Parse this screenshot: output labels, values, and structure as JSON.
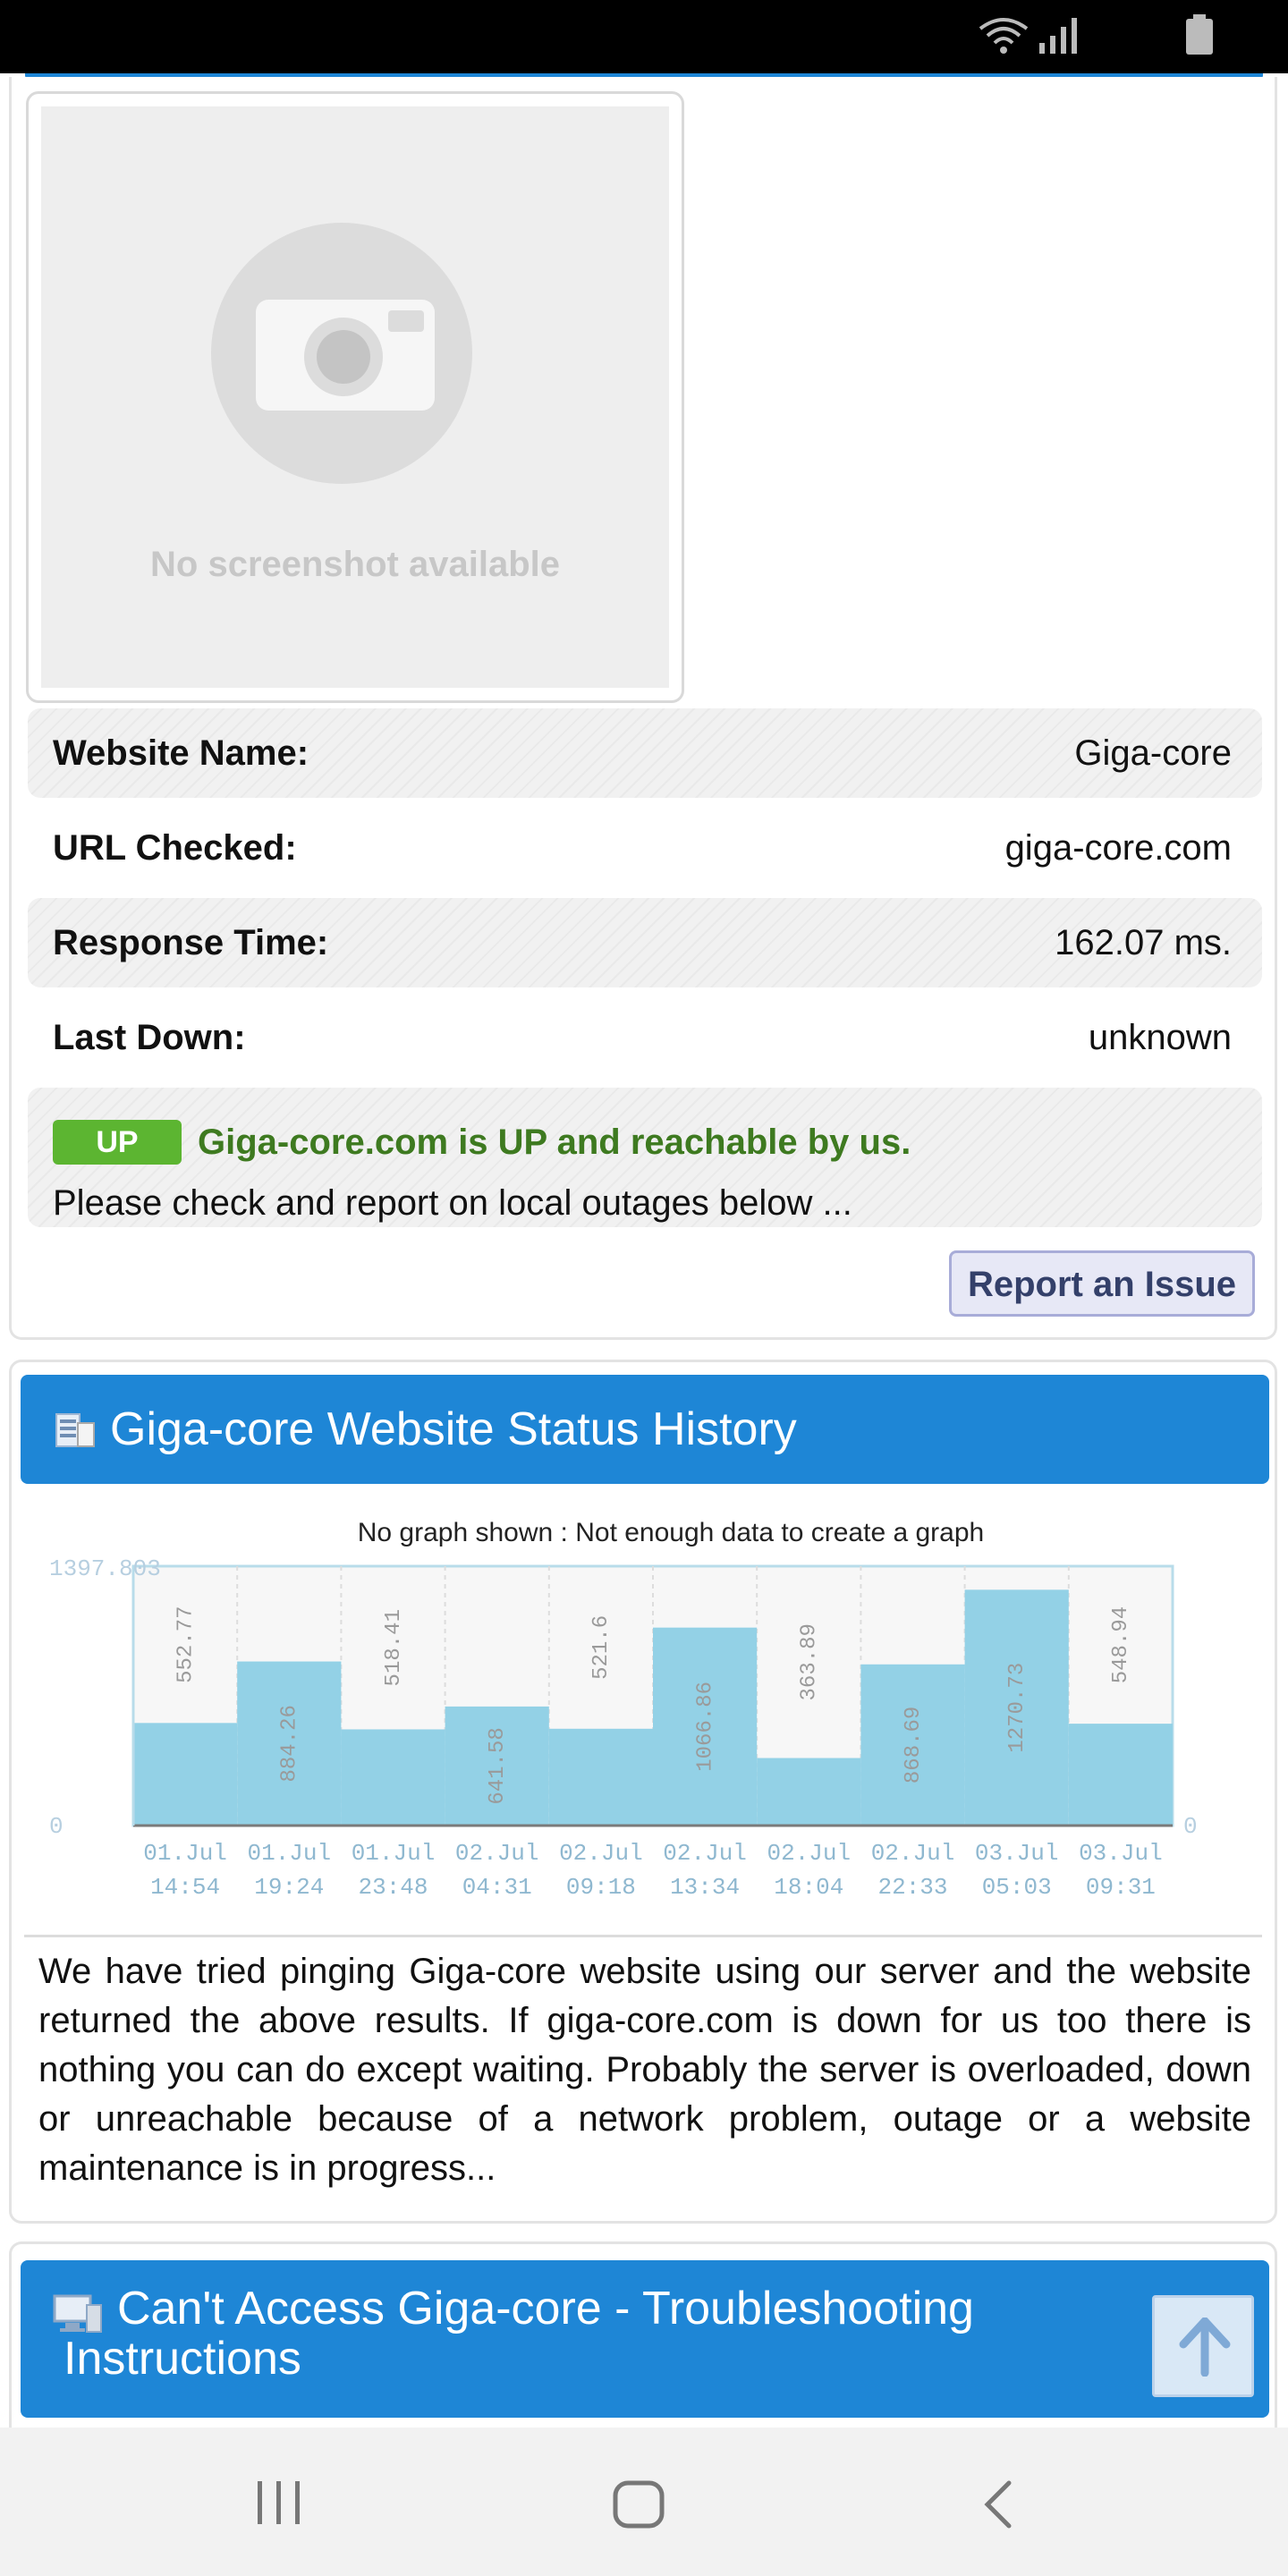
{
  "screenshot": {
    "placeholder_text": "No screenshot available"
  },
  "info_rows": [
    {
      "label": "Website Name:",
      "value": "Giga-core"
    },
    {
      "label": "URL Checked:",
      "value": "giga-core.com"
    },
    {
      "label": "Response Time:",
      "value": "162.07 ms."
    },
    {
      "label": "Last Down:",
      "value": "unknown"
    }
  ],
  "status": {
    "badge": "UP",
    "message": "Giga-core.com is UP and reachable by us.",
    "sub": "Please check and report on local outages below ..."
  },
  "report_button": "Report an Issue",
  "history": {
    "title": "Giga-core Website Status History",
    "description": "We have tried pinging Giga-core website using our server and the website returned the above results. If giga-core.com is down for us too there is nothing you can do except waiting. Probably the server is overloaded, down or unreachable because of a network problem, outage or a website maintenance is in progress..."
  },
  "chart_data": {
    "type": "bar",
    "title": "No graph shown : Not enough data to create a graph",
    "ymax_label": "1397.803",
    "ymin_label": "0",
    "right_label": "0",
    "ylim": [
      0,
      1397.803
    ],
    "categories": [
      [
        "01.Jul",
        "14:54"
      ],
      [
        "01.Jul",
        "19:24"
      ],
      [
        "01.Jul",
        "23:48"
      ],
      [
        "02.Jul",
        "04:31"
      ],
      [
        "02.Jul",
        "09:18"
      ],
      [
        "02.Jul",
        "13:34"
      ],
      [
        "02.Jul",
        "18:04"
      ],
      [
        "02.Jul",
        "22:33"
      ],
      [
        "03.Jul",
        "05:03"
      ],
      [
        "03.Jul",
        "09:31"
      ]
    ],
    "values": [
      552.77,
      884.26,
      518.41,
      641.58,
      521.6,
      1066.86,
      363.89,
      868.69,
      1270.73,
      548.94
    ],
    "value_labels": [
      "552.77",
      "884.26",
      "518.41",
      "641.58",
      "521.6",
      "1066.86",
      "363.89",
      "868.69",
      "1270.73",
      "548.94"
    ],
    "colors": {
      "bar": "#93d1e6",
      "frame": "#b8dcea",
      "text": "#8fb8d0"
    }
  },
  "troubleshoot": {
    "title": "Can't Access Giga-core - Troubleshooting Instructions"
  },
  "icons": {
    "status_wifi": "wifi-icon",
    "status_signal": "signal-icon",
    "status_battery": "battery-icon",
    "camera": "camera-icon",
    "history": "server-icon",
    "troubleshoot": "computer-icon",
    "back_to_top": "arrow-up-icon",
    "nav_recents": "recents-icon",
    "nav_home": "home-icon",
    "nav_back": "back-icon"
  }
}
